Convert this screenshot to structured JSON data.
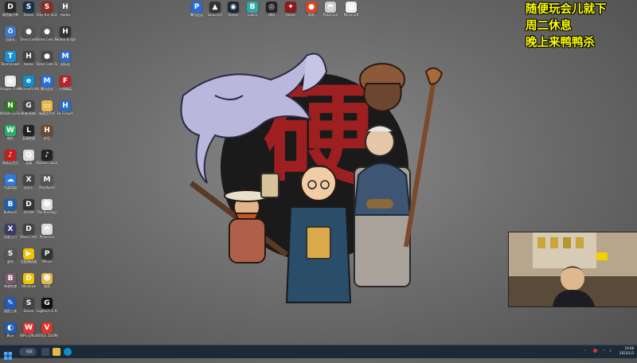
{
  "desktop_icons": [
    {
      "label": "暗黑破坏神",
      "color": "#2a2a2a",
      "sym": "D"
    },
    {
      "label": "Steam",
      "color": "#17324d",
      "sym": "S"
    },
    {
      "label": "Slay the Spire",
      "color": "#8b2c22",
      "sym": "S"
    },
    {
      "label": "Hades",
      "color": "#5a5a5a",
      "sym": "H"
    },
    {
      "label": "回收站",
      "color": "#3c77c4",
      "sym": "♻"
    },
    {
      "label": "Dead Cells",
      "color": "#555",
      "sym": "●"
    },
    {
      "label": "Dead Cells Soundtrack",
      "color": "#555",
      "sym": "●"
    },
    {
      "label": "Hollow Knight",
      "color": "#333",
      "sym": "H"
    },
    {
      "label": "TeamViewer",
      "color": "#1b8fd6",
      "sym": "T"
    },
    {
      "label": "Hades",
      "color": "#444",
      "sym": "H"
    },
    {
      "label": "Dead Cells Soundtrack",
      "color": "#4a4a4a",
      "sym": "●"
    },
    {
      "label": "鼠标宏",
      "color": "#2a6cc4",
      "sym": "M"
    },
    {
      "label": "Google Chrome",
      "color": "#e8eaed",
      "sym": "◉"
    },
    {
      "label": "Microsoft Edge",
      "color": "#0c8fd1",
      "sym": "e"
    },
    {
      "label": "腾讯会议",
      "color": "#1e6fe8",
      "sym": "M"
    },
    {
      "label": "火线精英",
      "color": "#b22",
      "sym": "F"
    },
    {
      "label": "NVIDIA GeForce Experience",
      "color": "#2d7a1f",
      "sym": "N"
    },
    {
      "label": "原神(原神)",
      "color": "#444",
      "sym": "G"
    },
    {
      "label": "新建文件夹",
      "color": "#e6b84a",
      "sym": "▭"
    },
    {
      "label": "Hi-Fi Rush",
      "color": "#2a6cc4",
      "sym": "H"
    },
    {
      "label": "微信",
      "color": "#2aae67",
      "sym": "W"
    },
    {
      "label": "英雄联盟",
      "color": "#222",
      "sym": "L"
    },
    {
      "label": "炉石",
      "color": "#6a4a2a",
      "sym": "H"
    },
    {
      "label": "",
      "color": "",
      "sym": ""
    },
    {
      "label": "网易云音乐",
      "color": "#c21f1f",
      "sym": "♪"
    },
    {
      "label": "英雄",
      "color": "#ddd",
      "sym": "Q"
    },
    {
      "label": "Bastion Soundtrack",
      "color": "#222",
      "sym": "♪"
    },
    {
      "label": "",
      "color": "",
      "sym": ""
    },
    {
      "label": "百度网盘",
      "color": "#2a7de1",
      "sym": "☁"
    },
    {
      "label": "仙剑七",
      "color": "#444",
      "sym": "X"
    },
    {
      "label": "MiniWorld",
      "color": "#555",
      "sym": "M"
    },
    {
      "label": "",
      "color": "",
      "sym": ""
    },
    {
      "label": "BetterGI",
      "color": "#1b5fb0",
      "sym": "B"
    },
    {
      "label": "DOOM",
      "color": "#333",
      "sym": "D"
    },
    {
      "label": "The Binding of Isaac",
      "color": "#ddd",
      "sym": "☻"
    },
    {
      "label": "",
      "color": "",
      "sym": ""
    },
    {
      "label": "异度之刃",
      "color": "#3a3a6a",
      "sym": "X"
    },
    {
      "label": "Dead Cells",
      "color": "#444",
      "sym": "D"
    },
    {
      "label": "Pokemon",
      "color": "#ddd",
      "sym": "◓"
    },
    {
      "label": "",
      "color": "",
      "sym": ""
    },
    {
      "label": "星穹",
      "color": "#555",
      "sym": "S"
    },
    {
      "label": "优酷播放器",
      "color": "#f2c200",
      "sym": "▶"
    },
    {
      "label": "PPLive",
      "color": "#333",
      "sym": "P"
    },
    {
      "label": "",
      "color": "",
      "sym": ""
    },
    {
      "label": "哔哩哔哩",
      "color": "#7a5a6a",
      "sym": "B"
    },
    {
      "label": "Windows",
      "color": "#f2c200",
      "sym": "D"
    },
    {
      "label": "暗黑",
      "color": "#e6b84a",
      "sym": "☻"
    },
    {
      "label": "",
      "color": "",
      "sym": ""
    },
    {
      "label": "画图工具",
      "color": "#1e5cb8",
      "sym": "✎"
    },
    {
      "label": "Steam",
      "color": "#444",
      "sym": "S"
    },
    {
      "label": "Logitech G HUB",
      "color": "#111",
      "sym": "G"
    },
    {
      "label": "",
      "color": "",
      "sym": ""
    },
    {
      "label": "Blue",
      "color": "#1f5cb5",
      "sym": "◐"
    },
    {
      "label": "WPS Office",
      "color": "#d33",
      "sym": "W"
    },
    {
      "label": "VOICE ZOOMER",
      "color": "#d32",
      "sym": "V"
    },
    {
      "label": "",
      "color": "",
      "sym": ""
    }
  ],
  "top_icons": [
    {
      "label": "腾讯会议",
      "color": "#2a6ad4",
      "sym": "P"
    },
    {
      "label": "Launcher",
      "color": "#333",
      "sym": "▲"
    },
    {
      "label": "Steam",
      "color": "#1b2838",
      "sym": "◉"
    },
    {
      "label": "bilibili",
      "color": "#3aa",
      "sym": "B"
    },
    {
      "label": "OBS",
      "color": "#222",
      "sym": "◎"
    },
    {
      "label": "Hades",
      "color": "#8b1a1a",
      "sym": "✦"
    },
    {
      "label": "网易",
      "color": "#d42",
      "sym": "●"
    },
    {
      "label": "Pokemon",
      "color": "#ccc",
      "sym": "◓"
    },
    {
      "label": "Minecraft",
      "color": "#eee",
      "sym": "▦"
    }
  ],
  "overlay": {
    "line1": "随便玩会儿就下",
    "line2": "周二休息",
    "line3": "晚上来鸭鸭杀"
  },
  "wallpaper": {
    "emblem_char": "硬"
  },
  "taskbar": {
    "search_label": "搜索",
    "clock_time": "19:08",
    "clock_date": "2023/1/3"
  }
}
